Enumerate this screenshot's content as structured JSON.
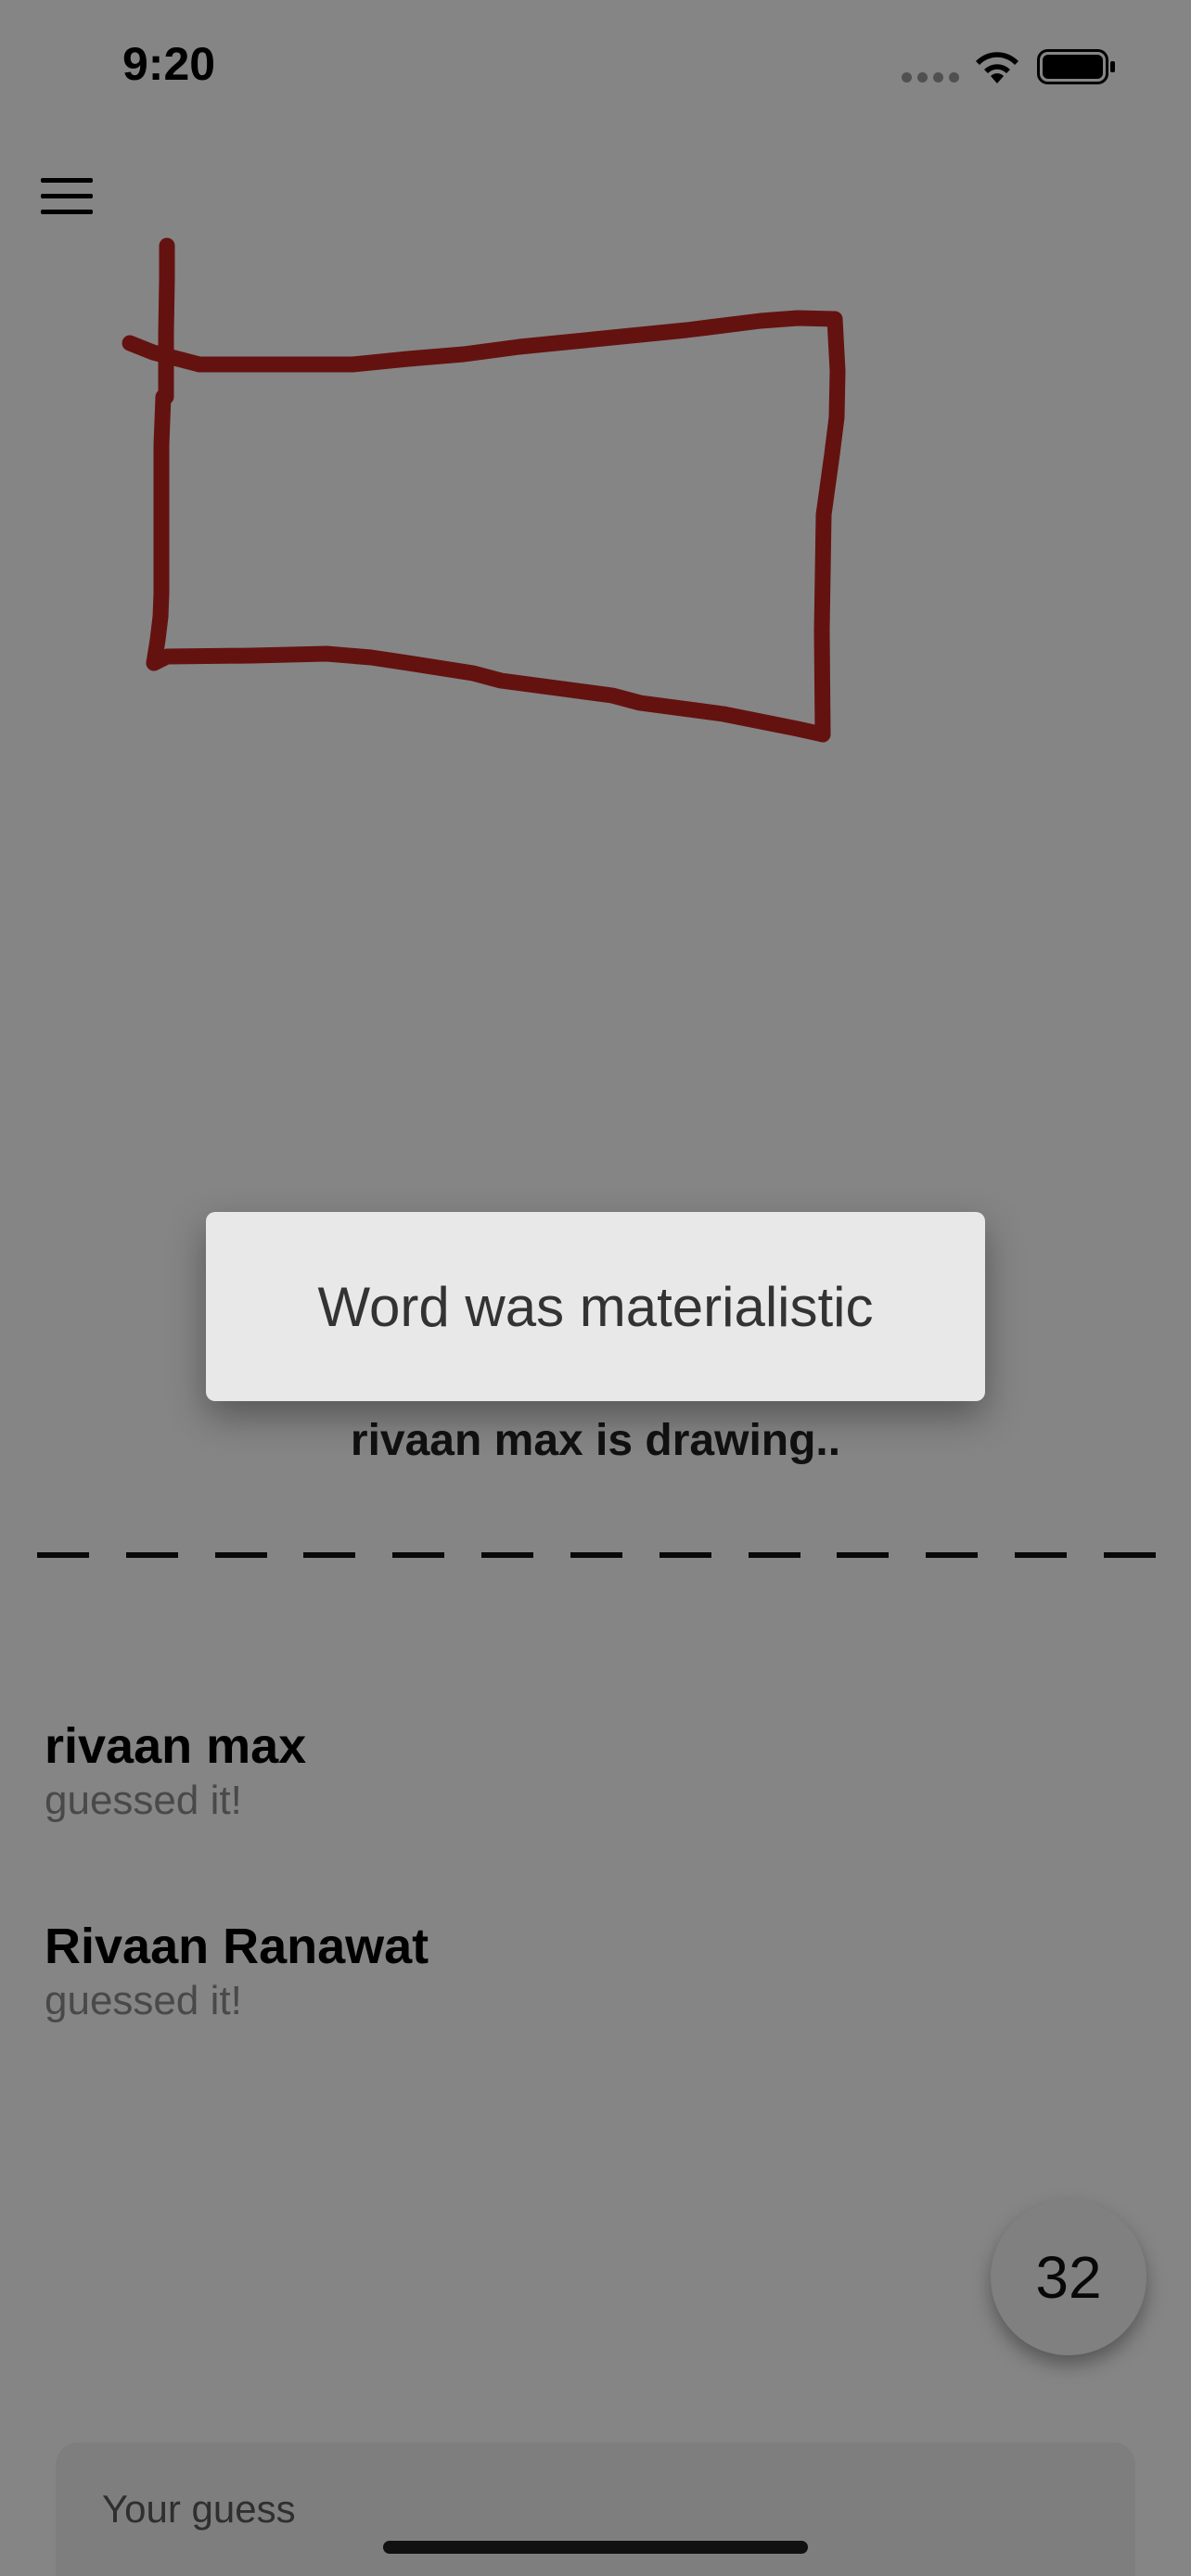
{
  "status_bar": {
    "time": "9:20"
  },
  "drawing": {
    "stroke_color": "#c0231f"
  },
  "drawer": {
    "label": "rivaan max is drawing.."
  },
  "word_blanks": {
    "count": 13
  },
  "guesses": [
    {
      "name": "rivaan max",
      "status": "guessed it!"
    },
    {
      "name": "Rivaan Ranawat",
      "status": "guessed it!"
    }
  ],
  "timer": {
    "seconds": "32"
  },
  "guess_input": {
    "placeholder": "Your guess"
  },
  "dialog": {
    "message": "Word was materialistic"
  },
  "icons": {
    "menu": "hamburger-menu-icon",
    "signal": "cellular-signal-icon",
    "wifi": "wifi-icon",
    "battery": "battery-icon"
  }
}
